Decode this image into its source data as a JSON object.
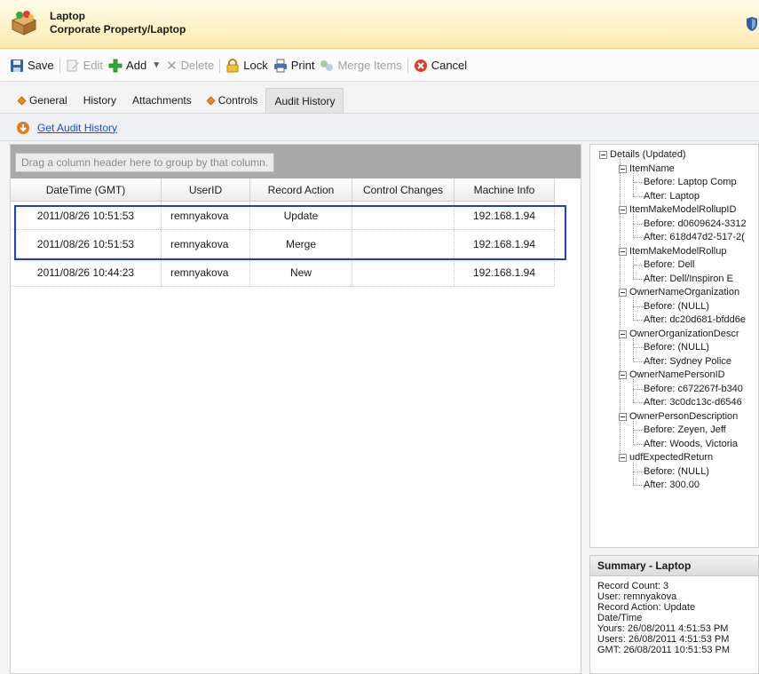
{
  "header": {
    "title": "Laptop",
    "subtitle": "Corporate Property/Laptop"
  },
  "toolbar": {
    "save": "Save",
    "edit": "Edit",
    "add": "Add",
    "delete": "Delete",
    "lock": "Lock",
    "print": "Print",
    "merge_items": "Merge Items",
    "cancel": "Cancel"
  },
  "tabs": [
    {
      "label": "General",
      "marked": true
    },
    {
      "label": "History",
      "marked": false
    },
    {
      "label": "Attachments",
      "marked": false
    },
    {
      "label": "Controls",
      "marked": true
    },
    {
      "label": "Audit History",
      "marked": false,
      "active": true
    }
  ],
  "audit_link": "Get Audit History",
  "grid": {
    "group_hint": "Drag a column header here to group by that column.",
    "columns": [
      "DateTime (GMT)",
      "UserID",
      "Record Action",
      "Control Changes",
      "Machine Info"
    ],
    "rows": [
      [
        "2011/08/26 10:51:53",
        "remnyakova",
        "Update",
        "",
        "192.168.1.94"
      ],
      [
        "2011/08/26 10:51:53",
        "remnyakova",
        "Merge",
        "",
        "192.168.1.94"
      ],
      [
        "2011/08/26 10:44:23",
        "remnyakova",
        "New",
        "",
        "192.168.1.94"
      ]
    ]
  },
  "details_tree": {
    "root": "Details (Updated)",
    "fields": [
      {
        "name": "ItemName",
        "before": "Before: Laptop Comp",
        "after": "After: Laptop"
      },
      {
        "name": "ItemMakeModelRollupID",
        "before": "Before: d0609624-3312",
        "after": "After: 618d47d2-517-2("
      },
      {
        "name": "ItemMakeModelRollup",
        "before": "Before: Dell",
        "after": "After: Dell/Inspiron E"
      },
      {
        "name": "OwnerNameOrganization",
        "before": "Before: (NULL)",
        "after": "After: dc20d681-bfdd6e"
      },
      {
        "name": "OwnerOrganizationDescr",
        "before": "Before: (NULL)",
        "after": "After: Sydney Police"
      },
      {
        "name": "OwnerNamePersonID",
        "before": "Before: c672267f-b340",
        "after": "After: 3c0dc13c-d6546"
      },
      {
        "name": "OwnerPersonDescription",
        "before": "Before: Zeyen, Jeff",
        "after": "After: Woods, Victoria"
      },
      {
        "name": "udfExpectedReturn",
        "before": "Before: (NULL)",
        "after": "After: 300.00"
      }
    ]
  },
  "summary": {
    "title": "Summary - Laptop",
    "lines": [
      "Record Count: 3",
      "User: remnyakova",
      "Record Action: Update",
      "Date/Time",
      "Yours: 26/08/2011 4:51:53 PM",
      "Users: 26/08/2011 4:51:53 PM",
      "GMT: 26/08/2011 10:51:53 PM"
    ]
  }
}
